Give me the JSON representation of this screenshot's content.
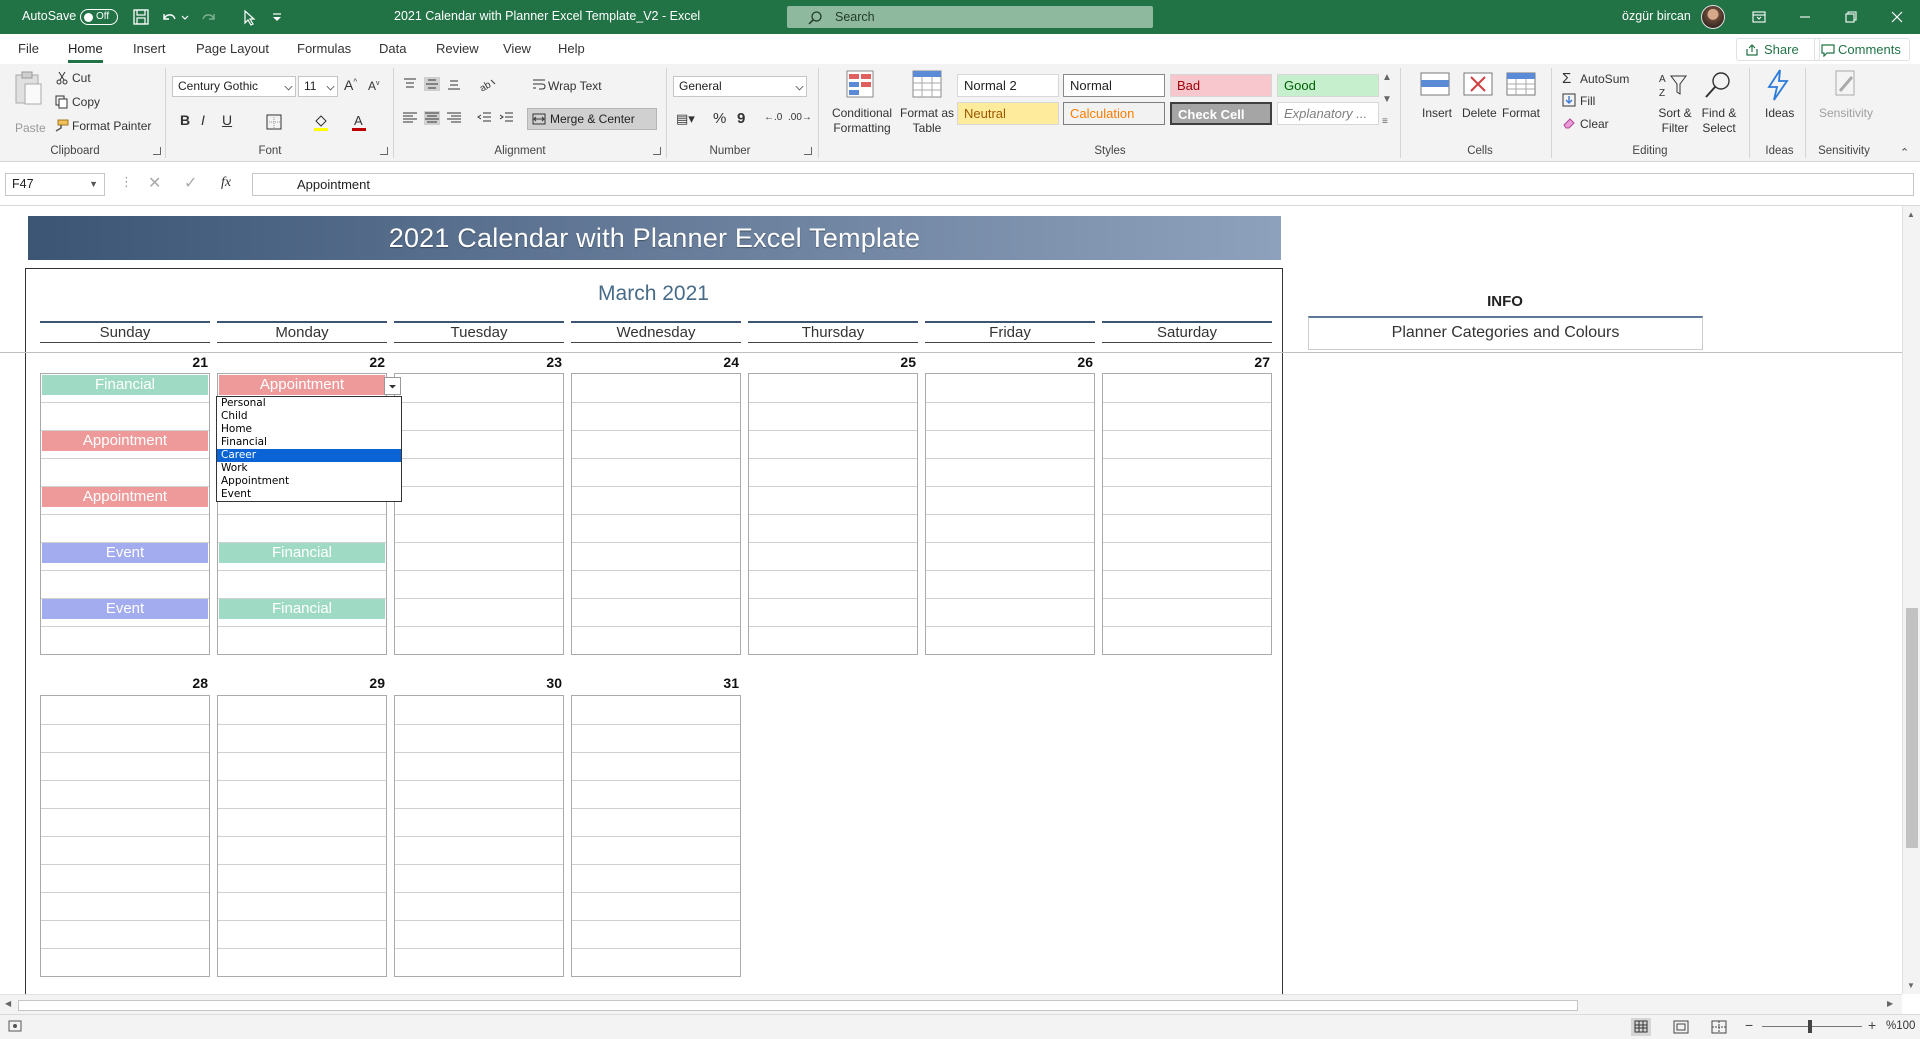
{
  "titlebar": {
    "autosave_label": "AutoSave",
    "autosave_state": "Off",
    "document_title": "2021 Calendar with Planner Excel Template_V2  -  Excel",
    "search_placeholder": "Search",
    "user_name": "özgür bircan",
    "accent": "#217346"
  },
  "tabs": [
    "File",
    "Home",
    "Insert",
    "Page Layout",
    "Formulas",
    "Data",
    "Review",
    "View",
    "Help"
  ],
  "active_tab": "Home",
  "share_label": "Share",
  "comments_label": "Comments",
  "ribbon": {
    "clipboard": {
      "paste": "Paste",
      "cut": "Cut",
      "copy": "Copy",
      "format_painter": "Format Painter",
      "label": "Clipboard"
    },
    "font": {
      "name": "Century Gothic",
      "size": "11",
      "label": "Font"
    },
    "alignment": {
      "wrap_text": "Wrap Text",
      "merge_center": "Merge & Center",
      "label": "Alignment"
    },
    "number": {
      "format": "General",
      "label": "Number"
    },
    "styles": {
      "conditional_formatting": "Conditional Formatting",
      "format_as_table": "Format as Table",
      "cells": [
        {
          "label": "Normal 2",
          "bg": "#ffffff",
          "color": "#222222"
        },
        {
          "label": "Normal",
          "bg": "#ffffff",
          "color": "#222222"
        },
        {
          "label": "Bad",
          "bg": "#f8c7ce",
          "color": "#9c0006"
        },
        {
          "label": "Good",
          "bg": "#c6efce",
          "color": "#006100"
        },
        {
          "label": "Neutral",
          "bg": "#ffeb9c",
          "color": "#9c5700"
        },
        {
          "label": "Calculation",
          "bg": "#f2f2f2",
          "color": "#fa7d00"
        },
        {
          "label": "Check Cell",
          "bg": "#a5a5a5",
          "color": "#ffffff"
        },
        {
          "label": "Explanatory ...",
          "bg": "#ffffff",
          "color": "#7f7f7f"
        }
      ],
      "label": "Styles"
    },
    "cells": {
      "insert": "Insert",
      "delete": "Delete",
      "format": "Format",
      "label": "Cells"
    },
    "editing": {
      "autosum": "AutoSum",
      "fill": "Fill",
      "clear": "Clear",
      "sort_filter": "Sort & Filter",
      "find_select": "Find & Select",
      "label": "Editing"
    },
    "ideas": {
      "ideas": "Ideas",
      "label": "Ideas"
    },
    "sensitivity": {
      "sensitivity": "Sensitivity",
      "label": "Sensitivity"
    }
  },
  "formula_bar": {
    "name_box": "F47",
    "fx": "fx",
    "value": "Appointment"
  },
  "sheet": {
    "banner_title": "2021 Calendar with Planner Excel Template",
    "month_title": "March 2021",
    "weekdays": [
      "Sunday",
      "Monday",
      "Tuesday",
      "Wednesday",
      "Thursday",
      "Friday",
      "Saturday"
    ],
    "week1_days": [
      "21",
      "22",
      "23",
      "24",
      "25",
      "26",
      "27"
    ],
    "week2_days": [
      "28",
      "29",
      "30",
      "31"
    ],
    "info_title": "INFO",
    "info_subtitle": "Planner Categories and Colours",
    "events": [
      {
        "day": "21",
        "slot": 0,
        "label": "Financial",
        "color": "#9fdbc4"
      },
      {
        "day": "21",
        "slot": 2,
        "label": "Appointment",
        "color": "#ee9a9a"
      },
      {
        "day": "21",
        "slot": 4,
        "label": "Appointment",
        "color": "#ee9a9a"
      },
      {
        "day": "21",
        "slot": 6,
        "label": "Event",
        "color": "#a2acef"
      },
      {
        "day": "21",
        "slot": 8,
        "label": "Event",
        "color": "#a2acef"
      },
      {
        "day": "22",
        "slot": 0,
        "label": "Appointment",
        "color": "#ee9a9a"
      },
      {
        "day": "22",
        "slot": 6,
        "label": "Financial",
        "color": "#9fdbc4"
      },
      {
        "day": "22",
        "slot": 8,
        "label": "Financial",
        "color": "#9fdbc4"
      }
    ],
    "dropdown_options": [
      "Personal",
      "Child",
      "Home",
      "Financial",
      "Career",
      "Work",
      "Appointment",
      "Event"
    ],
    "dropdown_selected": "Career"
  },
  "status": {
    "zoom": "%100"
  }
}
